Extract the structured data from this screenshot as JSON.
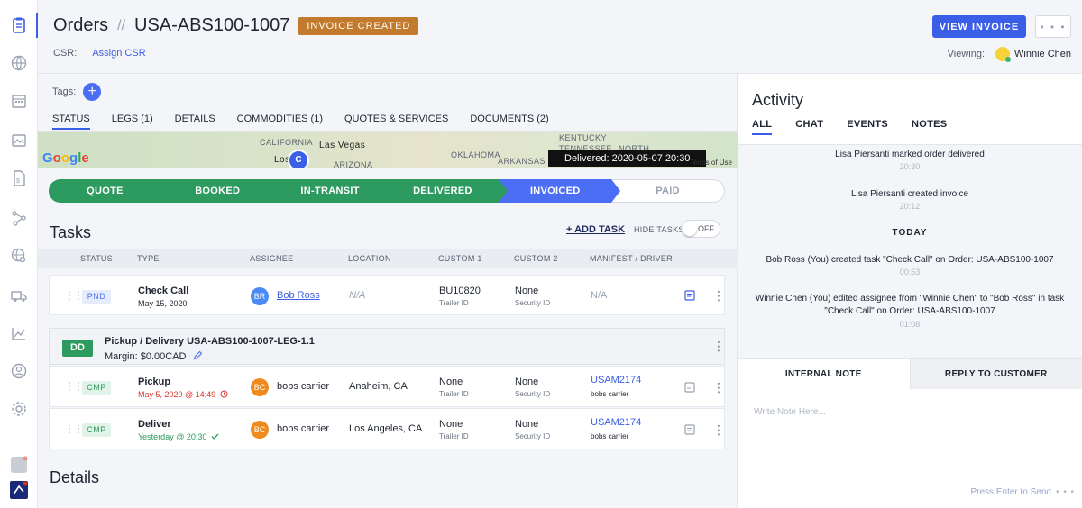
{
  "header": {
    "section": "Orders",
    "order_id": "USA-ABS100-1007",
    "status_badge": "INVOICE CREATED",
    "csr_label": "CSR:",
    "csr_action": "Assign CSR",
    "view_invoice": "VIEW INVOICE",
    "more": "• • •",
    "viewing_label": "Viewing:",
    "viewer_name": "Winnie Chen"
  },
  "tags_label": "Tags:",
  "tabs": [
    {
      "label": "STATUS"
    },
    {
      "label": "LEGS (1)"
    },
    {
      "label": "DETAILS"
    },
    {
      "label": "COMMODITIES (1)"
    },
    {
      "label": "QUOTES & SERVICES"
    },
    {
      "label": "DOCUMENTS (2)"
    }
  ],
  "map": {
    "labels": [
      "CALIFORNIA",
      "Las Vegas",
      "Los",
      "ARIZONA",
      "OKLAHOMA",
      "ARKANSAS",
      "KENTUCKY",
      "TENNESSEE",
      "NORTH"
    ],
    "marker": "C",
    "tooltip": "Delivered: 2020-05-07 20:30",
    "terms": "Terms of Use"
  },
  "progress": [
    {
      "label": "QUOTE",
      "state": "done"
    },
    {
      "label": "BOOKED",
      "state": "done"
    },
    {
      "label": "IN-TRANSIT",
      "state": "done"
    },
    {
      "label": "DELIVERED",
      "state": "done"
    },
    {
      "label": "INVOICED",
      "state": "current"
    },
    {
      "label": "PAID",
      "state": "todo"
    }
  ],
  "tasks": {
    "title": "Tasks",
    "add_task": "+ ADD TASK",
    "hide_tasks": "HIDE TASKS",
    "toggle": "OFF",
    "columns": [
      "STATUS",
      "TYPE",
      "ASSIGNEE",
      "LOCATION",
      "CUSTOM 1",
      "CUSTOM 2",
      "MANIFEST / DRIVER"
    ],
    "check_call": {
      "status": "PND",
      "type": "Check Call",
      "date": "May 15, 2020",
      "avatar": "BR",
      "assignee": "Bob Ross",
      "location": "N/A",
      "c1": "BU10820",
      "c1_label": "Trailer ID",
      "c2": "None",
      "c2_label": "Security ID",
      "manifest": "N/A"
    },
    "leg": {
      "badge": "DD",
      "title": "Pickup / Delivery USA-ABS100-1007-LEG-1.1",
      "margin": "Margin: $0.00CAD"
    },
    "rows": [
      {
        "status": "CMP",
        "type": "Pickup",
        "date": "May 5, 2020 @ 14:49",
        "date_icon": "clock-icon",
        "avatar": "BC",
        "assignee": "bobs carrier",
        "location": "Anaheim, CA",
        "c1": "None",
        "c1_label": "Trailer ID",
        "c2": "None",
        "c2_label": "Security ID",
        "manifest": "USAM2174",
        "driver": "bobs carrier"
      },
      {
        "status": "CMP",
        "type": "Deliver",
        "date": "Yesterday @ 20:30",
        "date_icon": "check-icon",
        "avatar": "BC",
        "assignee": "bobs carrier",
        "location": "Los Angeles, CA",
        "c1": "None",
        "c1_label": "Trailer ID",
        "c2": "None",
        "c2_label": "Security ID",
        "manifest": "USAM2174",
        "driver": "bobs carrier"
      }
    ]
  },
  "details_title": "Details",
  "activity": {
    "title": "Activity",
    "tabs": [
      "ALL",
      "CHAT",
      "EVENTS",
      "NOTES"
    ],
    "feed": [
      {
        "text": "Lisa Piersanti marked order delivered",
        "time": "20:30"
      },
      {
        "text": "Lisa Piersanti created invoice",
        "time": "20:12"
      },
      {
        "day": "TODAY"
      },
      {
        "text": "Bob Ross (You) created task \"Check Call\" on Order: USA-ABS100-1007",
        "time": "00:53"
      },
      {
        "text": "Winnie Chen (You) edited assignee from \"Winnie Chen\" to \"Bob Ross\" in task \"Check Call\" on Order: USA-ABS100-1007",
        "time": "01:08"
      }
    ],
    "compose_tabs": [
      "INTERNAL NOTE",
      "REPLY TO CUSTOMER"
    ],
    "placeholder": "Write Note Here...",
    "send_hint": "Press Enter to Send",
    "send_more": "• • •"
  },
  "colors": {
    "accent": "#3b5ee6",
    "done": "#2d9a5f",
    "badge": "#c27a2c"
  },
  "rail_icons": [
    "clipboard-icon",
    "globe-icon",
    "calendar-icon",
    "map-icon",
    "document-icon",
    "network-icon",
    "globe-search-icon",
    "truck-icon",
    "chart-icon",
    "users-icon",
    "settings-icon",
    "app-icon",
    "brand-logo-icon"
  ]
}
